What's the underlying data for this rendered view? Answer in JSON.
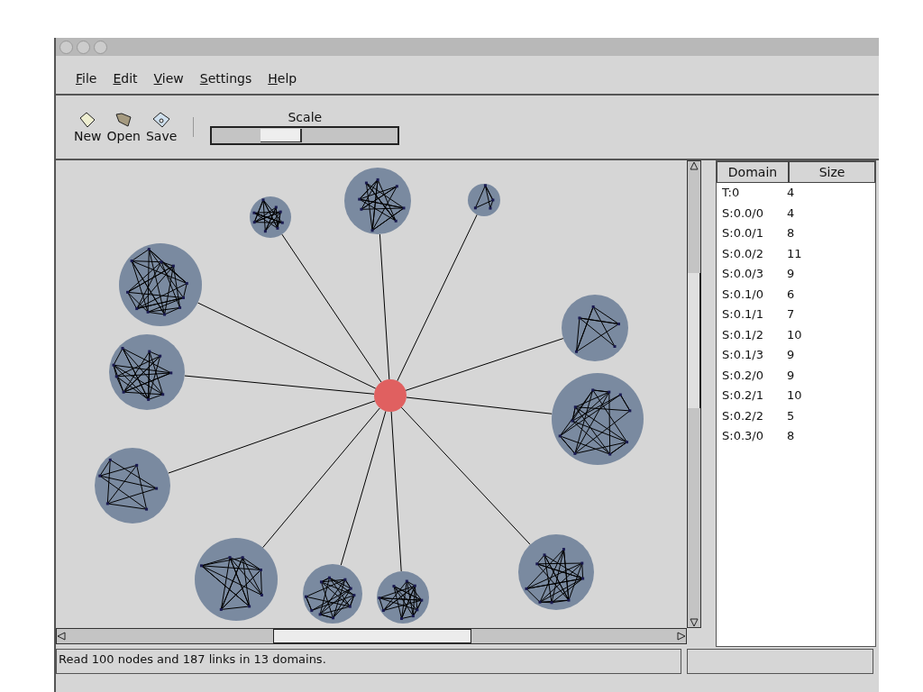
{
  "menu": [
    "File",
    "Edit",
    "View",
    "Settings",
    "Help"
  ],
  "toolbar": [
    {
      "kind": "new",
      "label": "New"
    },
    {
      "kind": "open",
      "label": "Open"
    },
    {
      "kind": "save",
      "label": "Save"
    }
  ],
  "scale": {
    "label": "Scale",
    "level": 0.35
  },
  "domains": {
    "columns": [
      "Domain",
      "Size"
    ],
    "rows": [
      {
        "domain": "T:0",
        "size": "4"
      },
      {
        "domain": "S:0.0/0",
        "size": "4"
      },
      {
        "domain": "S:0.0/1",
        "size": "8"
      },
      {
        "domain": "S:0.0/2",
        "size": "11"
      },
      {
        "domain": "S:0.0/3",
        "size": "9"
      },
      {
        "domain": "S:0.1/0",
        "size": "6"
      },
      {
        "domain": "S:0.1/1",
        "size": "7"
      },
      {
        "domain": "S:0.1/2",
        "size": "10"
      },
      {
        "domain": "S:0.1/3",
        "size": "9"
      },
      {
        "domain": "S:0.2/0",
        "size": "9"
      },
      {
        "domain": "S:0.2/1",
        "size": "10"
      },
      {
        "domain": "S:0.2/2",
        "size": "5"
      },
      {
        "domain": "S:0.3/0",
        "size": "8"
      }
    ]
  },
  "status_bar": "Read 100 nodes and 187 links in 13 domains."
}
